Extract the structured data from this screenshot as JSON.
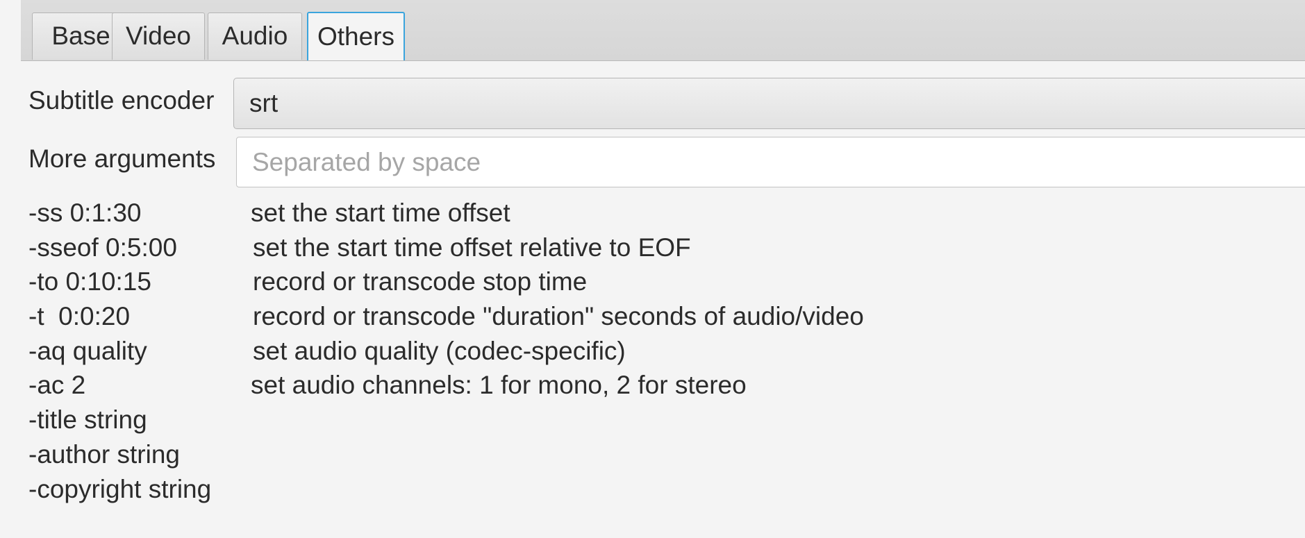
{
  "tabs": [
    {
      "label": "Base"
    },
    {
      "label": "Video"
    },
    {
      "label": "Audio"
    },
    {
      "label": "Others"
    }
  ],
  "active_tab": "Others",
  "subtitle_encoder": {
    "label": "Subtitle encoder",
    "value": "srt"
  },
  "more_arguments": {
    "label": "More arguments",
    "value": "",
    "placeholder": "Separated by space"
  },
  "help": [
    {
      "option": "-ss 0:1:30",
      "description": "set the start time offset"
    },
    {
      "option": "-sseof 0:5:00",
      "description": "set the start time offset relative to EOF"
    },
    {
      "option": "-to 0:10:15",
      "description": "record or transcode stop time"
    },
    {
      "option": "-t  0:0:20",
      "description": "record or transcode \"duration\" seconds of audio/video"
    },
    {
      "option": "-aq quality",
      "description": "set audio quality (codec-specific)"
    },
    {
      "option": "-ac 2",
      "description": "set audio channels: 1 for mono, 2 for stereo"
    },
    {
      "option": "-title string",
      "description": ""
    },
    {
      "option": "-author string",
      "description": ""
    },
    {
      "option": "-copyright string",
      "description": ""
    }
  ]
}
